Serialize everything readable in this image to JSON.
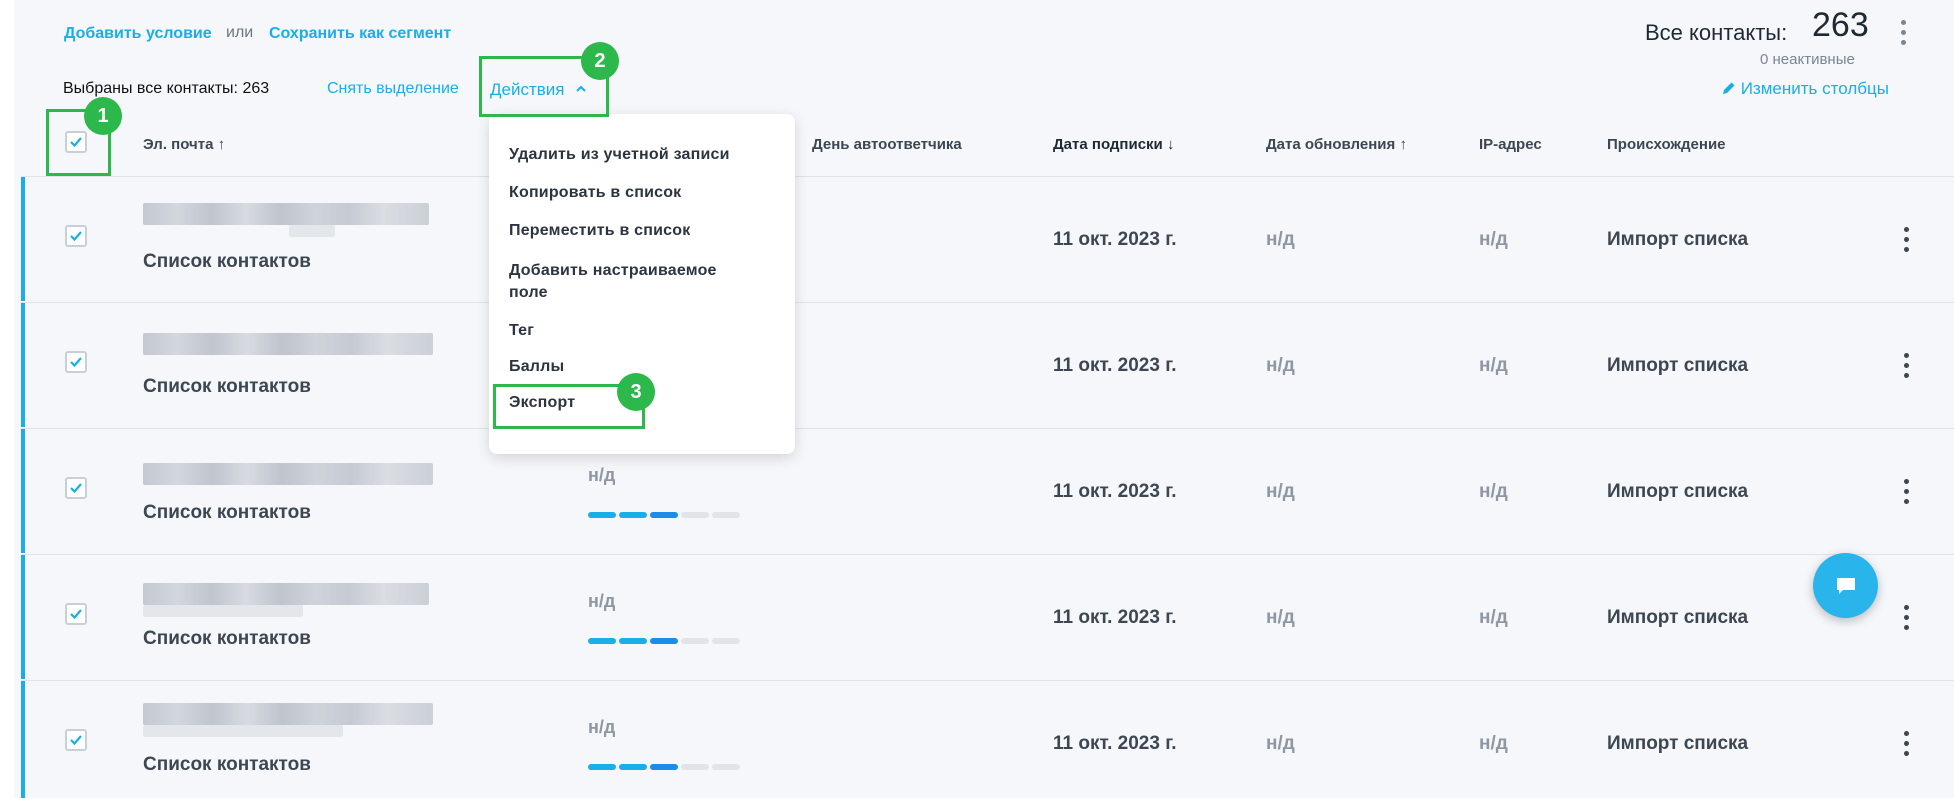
{
  "toolbar": {
    "add_condition": "Добавить условие",
    "or": "или",
    "save_segment": "Сохранить как сегмент",
    "all_contacts_label": "Все контакты:",
    "all_contacts_count": "263",
    "inactive": "0 неактивные",
    "selected_all": "Выбраны все контакты: 263",
    "clear_selection": "Снять выделение",
    "actions": "Действия",
    "change_columns": "Изменить столбцы"
  },
  "columns": {
    "email": "Эл. почта",
    "autoresponder_day": "День автоответчика",
    "subscribe_date": "Дата подписки",
    "update_date": "Дата обновления",
    "ip": "IP-адрес",
    "origin": "Происхождение"
  },
  "rows": [
    {
      "list": "Список контактов",
      "score": "",
      "date": "11 окт. 2023 г.",
      "updated": "н/д",
      "ip": "н/д",
      "origin": "Импорт списка",
      "checked": true
    },
    {
      "list": "Список контактов",
      "score": "",
      "date": "11 окт. 2023 г.",
      "updated": "н/д",
      "ip": "н/д",
      "origin": "Импорт списка",
      "checked": true
    },
    {
      "list": "Список контактов",
      "score": "н/д",
      "date": "11 окт. 2023 г.",
      "updated": "н/д",
      "ip": "н/д",
      "origin": "Импорт списка",
      "checked": true
    },
    {
      "list": "Список контактов",
      "score": "н/д",
      "date": "11 окт. 2023 г.",
      "updated": "н/д",
      "ip": "н/д",
      "origin": "Импорт списка",
      "checked": true
    },
    {
      "list": "Список контактов",
      "score": "н/д",
      "date": "11 окт. 2023 г.",
      "updated": "н/д",
      "ip": "н/д",
      "origin": "Импорт списка",
      "checked": true
    }
  ],
  "dropdown": {
    "items": [
      "Удалить из учетной записи",
      "Копировать в список",
      "Переместить в список",
      "Добавить настраиваемое поле",
      "Тег",
      "Баллы",
      "Экспорт"
    ],
    "item_add_field_line1": "Добавить настраиваемое",
    "item_add_field_line2": "поле"
  },
  "annotations": {
    "badge_1": "1",
    "badge_2": "2",
    "badge_3": "3"
  },
  "colors": {
    "accent": "#1aaee8",
    "highlight": "#2db84b",
    "background": "#f5f7fa"
  },
  "icons": {
    "sort_up": "arrow-up-icon",
    "sort_down": "arrow-down-icon",
    "pencil": "pencil-icon",
    "chat": "chat-icon",
    "kebab": "kebab-menu-icon",
    "chevron": "chevron-up-icon"
  }
}
